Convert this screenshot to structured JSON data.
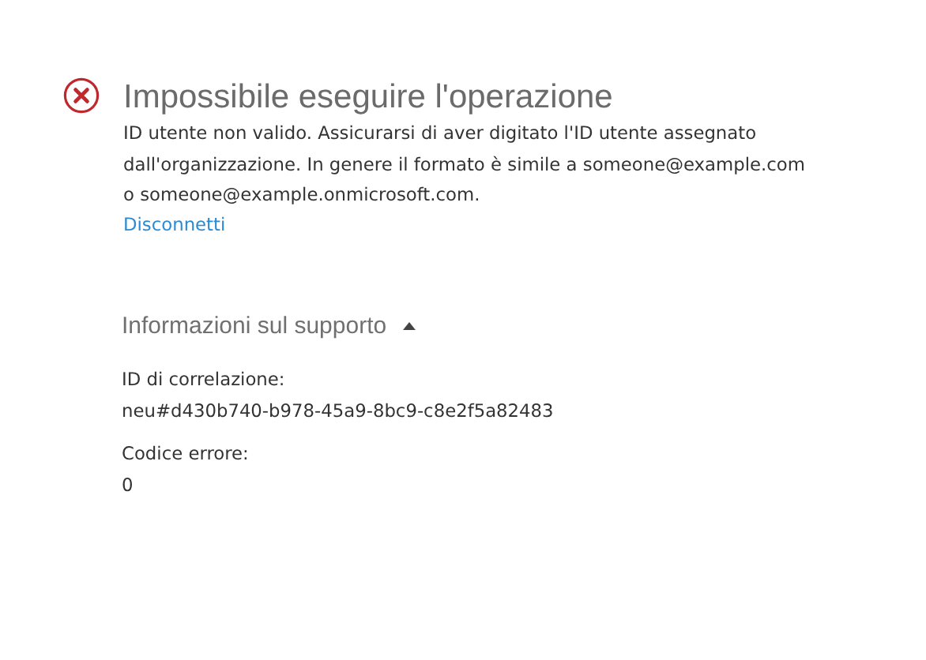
{
  "error": {
    "title": "Impossibile eseguire l'operazione",
    "message": "ID utente non valido. Assicurarsi di aver digitato l'ID utente assegnato dall'organizzazione. In genere il formato è simile a someone@example.com o someone@example.onmicrosoft.com.",
    "link": "Disconnetti"
  },
  "support": {
    "heading": "Informazioni sul supporto",
    "expanded": true,
    "fields": [
      {
        "label": "ID di correlazione:",
        "value": "neu#d430b740-b978-45a9-8bc9-c8e2f5a82483"
      },
      {
        "label": "Codice errore:",
        "value": "0"
      }
    ]
  }
}
